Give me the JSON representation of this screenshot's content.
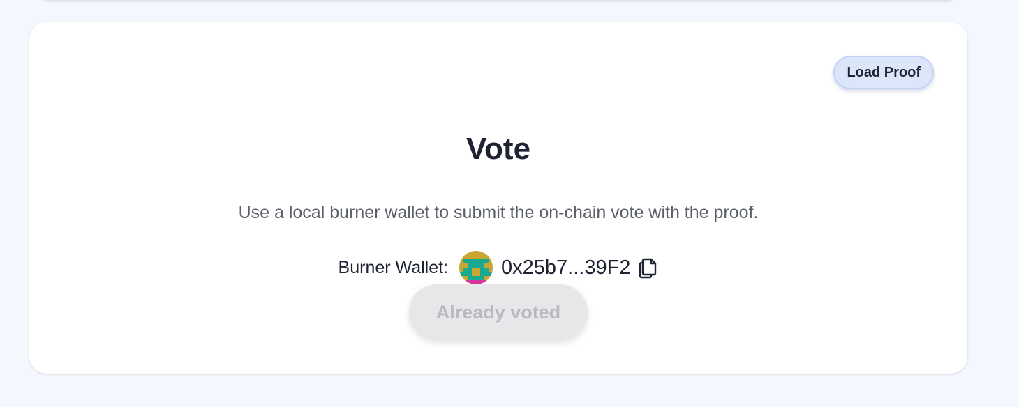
{
  "card": {
    "load_proof_label": "Load Proof",
    "title": "Vote",
    "description": "Use a local burner wallet to submit the on-chain vote with the proof.",
    "wallet": {
      "label": "Burner Wallet:",
      "address": "0x25b7...39F2",
      "avatar_icon": "blockie-avatar-icon",
      "copy_icon": "copy-icon"
    },
    "vote_button_label": "Already voted",
    "vote_button_disabled": true
  },
  "colors": {
    "page_background": "#f4f7fd",
    "card_background": "#ffffff",
    "load_proof_background": "#dbe6fb",
    "title_text": "#1f2233",
    "disabled_button_background": "#e7e7ea",
    "disabled_button_text": "#b9bac0"
  }
}
